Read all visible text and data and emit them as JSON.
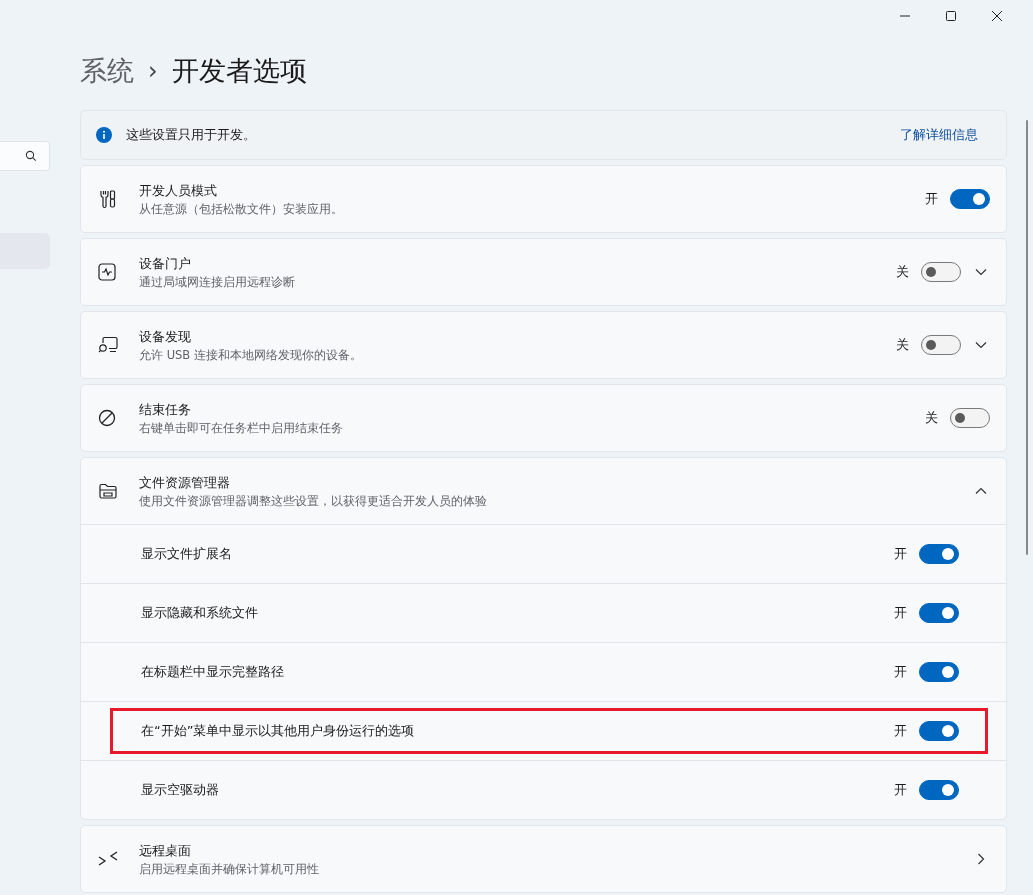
{
  "breadcrumb": {
    "parent": "系统",
    "separator": "›",
    "current": "开发者选项"
  },
  "info": {
    "text": "这些设置只用于开发。",
    "link": "了解详细信息"
  },
  "settings": [
    {
      "kind": "toggle",
      "title": "开发人员模式",
      "subtitle": "从任意源（包括松散文件）安装应用。",
      "state_label": "开",
      "on": true
    },
    {
      "kind": "expander",
      "title": "设备门户",
      "subtitle": "通过局域网连接启用远程诊断",
      "state_label": "关",
      "on": false,
      "expanded": false
    },
    {
      "kind": "expander",
      "title": "设备发现",
      "subtitle": "允许 USB 连接和本地网络发现你的设备。",
      "state_label": "关",
      "on": false,
      "expanded": false
    },
    {
      "kind": "toggle",
      "title": "结束任务",
      "subtitle": "右键单击即可在任务栏中启用结束任务",
      "state_label": "关",
      "on": false
    },
    {
      "kind": "group",
      "title": "文件资源管理器",
      "subtitle": "使用文件资源管理器调整这些设置，以获得更适合开发人员的体验",
      "expanded": true,
      "children": [
        {
          "title": "显示文件扩展名",
          "state_label": "开",
          "on": true,
          "highlighted": false
        },
        {
          "title": "显示隐藏和系统文件",
          "state_label": "开",
          "on": true,
          "highlighted": false
        },
        {
          "title": "在标题栏中显示完整路径",
          "state_label": "开",
          "on": true,
          "highlighted": false
        },
        {
          "title": "在“开始”菜单中显示以其他用户身份运行的选项",
          "state_label": "开",
          "on": true,
          "highlighted": true
        },
        {
          "title": "显示空驱动器",
          "state_label": "开",
          "on": true,
          "highlighted": false
        }
      ]
    },
    {
      "kind": "link",
      "title": "远程桌面",
      "subtitle": "启用远程桌面并确保计算机可用性"
    }
  ]
}
